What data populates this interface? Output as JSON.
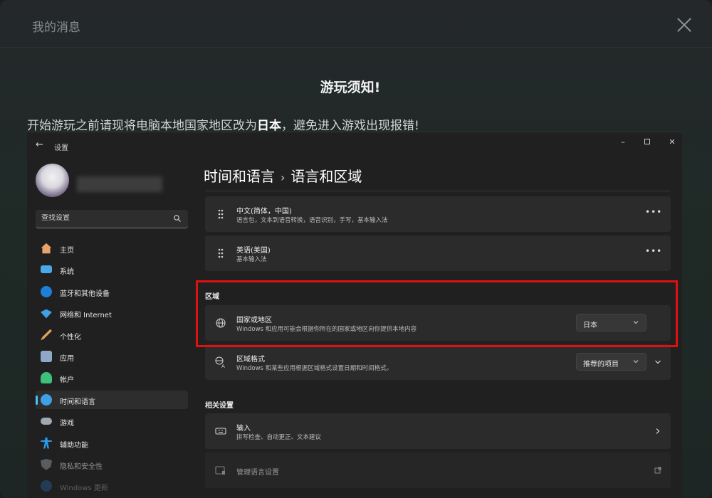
{
  "modal": {
    "title": "我的消息",
    "heading": "游玩须知!",
    "notice_prefix": "开始游玩之前请现将电脑本地国家地区改为",
    "notice_bold": "日本",
    "notice_suffix": "，避免进入游戏出现报错!"
  },
  "window": {
    "title": "设置",
    "controls": [
      "minimize-icon",
      "maximize-icon",
      "close-icon"
    ]
  },
  "sidebar": {
    "search_placeholder": "查找设置",
    "items": [
      {
        "label": "主页",
        "icon": "home-icon",
        "color": "#e8a26a"
      },
      {
        "label": "系统",
        "icon": "monitor-icon",
        "color": "#4aa8e8"
      },
      {
        "label": "蓝牙和其他设备",
        "icon": "bluetooth-icon",
        "color": "#1e7fd6"
      },
      {
        "label": "网络和 Internet",
        "icon": "wifi-icon",
        "color": "#3fa0e6"
      },
      {
        "label": "个性化",
        "icon": "brush-icon",
        "color": "#e0a25a"
      },
      {
        "label": "应用",
        "icon": "apps-icon",
        "color": "#8fa8c8"
      },
      {
        "label": "帐户",
        "icon": "account-icon",
        "color": "#3cc07a"
      },
      {
        "label": "时间和语言",
        "icon": "clock-globe-icon",
        "color": "#3fa0e6"
      },
      {
        "label": "游戏",
        "icon": "gamepad-icon",
        "color": "#a0a8b0"
      },
      {
        "label": "辅助功能",
        "icon": "accessibility-icon",
        "color": "#2b9be8"
      },
      {
        "label": "隐私和安全性",
        "icon": "shield-icon",
        "color": "#8a8f96"
      },
      {
        "label": "Windows 更新",
        "icon": "update-icon",
        "color": "#2b7fd0"
      }
    ]
  },
  "page": {
    "breadcrumb_parent": "时间和语言",
    "breadcrumb_sep": "›",
    "breadcrumb_current": "语言和区域"
  },
  "languages": [
    {
      "title": "中文(简体，中国)",
      "desc": "语言包，文本到语音转换，语音识别，手写，基本输入法"
    },
    {
      "title": "英语(美国)",
      "desc": "基本输入法"
    }
  ],
  "region": {
    "section_label": "区域",
    "country": {
      "title": "国家或地区",
      "desc": "Windows 和应用可能会根据你所在的国家或地区向你提供本地内容",
      "value": "日本"
    },
    "format": {
      "title": "区域格式",
      "desc": "Windows 和某些应用根据区域格式设置日期和时间格式。",
      "value": "推荐的项目"
    }
  },
  "related": {
    "section_label": "相关设置",
    "input": {
      "title": "输入",
      "desc": "拼写检查、自动更正、文本建议"
    },
    "manage": {
      "title": "管理语言设置"
    }
  },
  "colors": {
    "accent": "#4cc2ff",
    "highlight": "#e01010"
  }
}
